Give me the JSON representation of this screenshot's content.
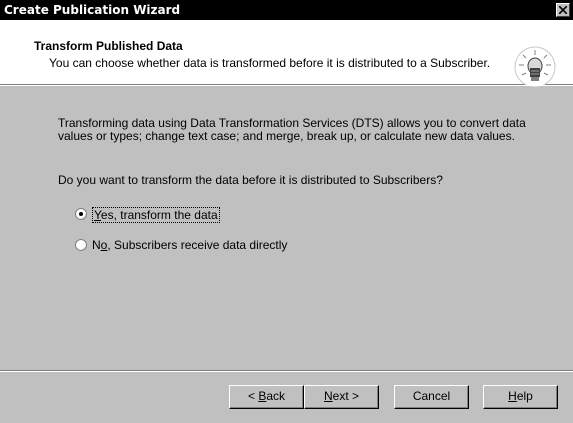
{
  "window": {
    "title": "Create Publication Wizard",
    "close_symbol": "✕"
  },
  "header": {
    "title": "Transform Published Data",
    "description": "You can choose whether data is transformed before it is distributed to a Subscriber.",
    "icon": "wizard-lightbulb-icon"
  },
  "content": {
    "paragraph": "Transforming data using Data Transformation Services (DTS) allows you to convert data values or types; change text case; and merge, break up, or calculate new data values.",
    "question": "Do you want to transform the data before it is distributed to Subscribers?"
  },
  "options": [
    {
      "label_hotkey": "Y",
      "label_rest": "es, transform the data",
      "selected": true
    },
    {
      "label_pre": "N",
      "label_hotkey": "o",
      "label_rest": ", Subscribers receive data directly",
      "selected": false
    }
  ],
  "buttons": {
    "back_prefix": "< ",
    "back_hotkey": "B",
    "back_rest": "ack",
    "next_hotkey": "N",
    "next_rest": "ext >",
    "cancel": "Cancel",
    "help_hotkey": "H",
    "help_rest": "elp"
  },
  "colors": {
    "titlebar": "#000000",
    "header_bg": "#ffffff",
    "dialog_bg": "#c0c0c0"
  }
}
